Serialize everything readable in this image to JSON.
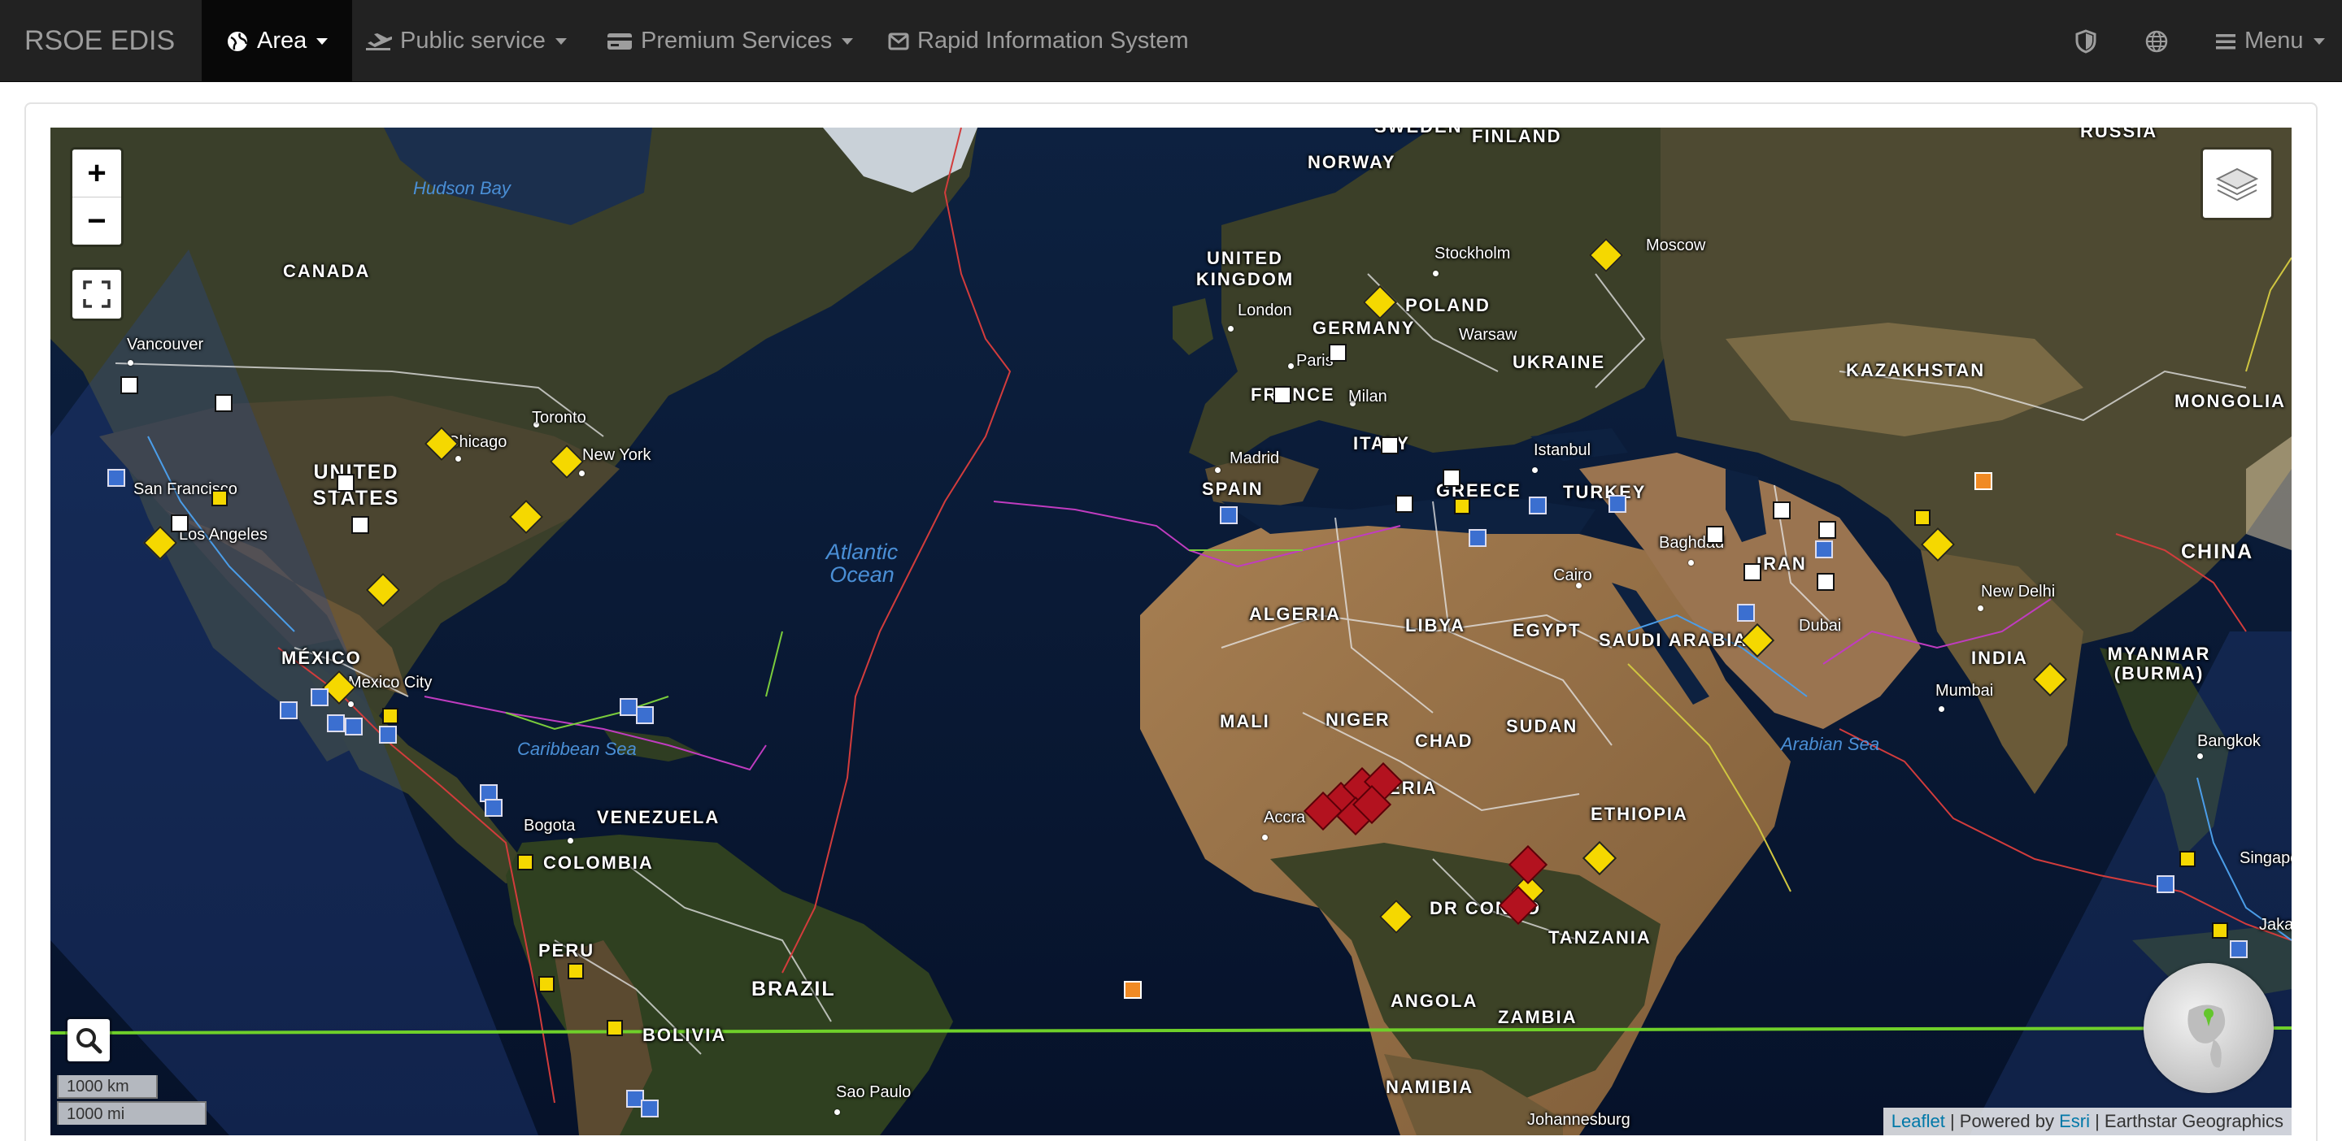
{
  "navbar": {
    "brand": "RSOE EDIS",
    "items": [
      {
        "label": "Area",
        "icon": "globe-icon",
        "active": true
      },
      {
        "label": "Public service",
        "icon": "plane-icon"
      },
      {
        "label": "Premium Services",
        "icon": "credit-card-icon"
      },
      {
        "label": "Rapid Information System",
        "icon": "envelope-icon"
      }
    ],
    "right": {
      "shield_icon": "shield-icon",
      "globe_icon": "globe-icon",
      "menu_label": "Menu"
    }
  },
  "map": {
    "zoom_in": "+",
    "zoom_out": "−",
    "scale_km": "1000 km",
    "scale_mi": "1000 mi",
    "attribution": {
      "leaflet": "Leaflet",
      "powered_by": " | Powered by ",
      "esri": "Esri",
      "rest": " | Earthstar Geographics"
    },
    "country_labels": [
      "CANADA",
      "UNITED STATES",
      "MÉXICO",
      "VENEZUELA",
      "COLOMBIA",
      "PERU",
      "BRAZIL",
      "BOLIVIA",
      "NORWAY",
      "FINLAND",
      "SWEDEN",
      "UNITED KINGDOM",
      "GERMANY",
      "POLAND",
      "UKRAINE",
      "FRANCE",
      "ITALY",
      "SPAIN",
      "GREECE",
      "TURKEY",
      "ALGERIA",
      "LIBYA",
      "EGYPT",
      "MALI",
      "NIGER",
      "CHAD",
      "SUDAN",
      "NIGERIA",
      "ETHIOPIA",
      "DR CONGO",
      "TANZANIA",
      "ANGOLA",
      "ZAMBIA",
      "NAMIBIA",
      "SAUDI ARABIA",
      "IRAN",
      "KAZAKHSTAN",
      "RUSSIA",
      "MONGOLIA",
      "CHINA",
      "INDIA",
      "MYANMAR (BURMA)"
    ],
    "city_labels": [
      "Vancouver",
      "San Francisco",
      "Los Angeles",
      "Chicago",
      "Toronto",
      "New York",
      "Mexico City",
      "Bogota",
      "Sao Paulo",
      "London",
      "Paris",
      "Milan",
      "Madrid",
      "Stockholm",
      "Warsaw",
      "Moscow",
      "Istanbul",
      "Cairo",
      "Baghdad",
      "Dubai",
      "New Delhi",
      "Mumbai",
      "Bangkok",
      "Singapore",
      "Jakarta",
      "Accra",
      "Johannesburg"
    ],
    "ocean_labels": [
      "Hudson Bay",
      "Atlantic Ocean",
      "Caribbean Sea",
      "Arabian Sea"
    ]
  }
}
